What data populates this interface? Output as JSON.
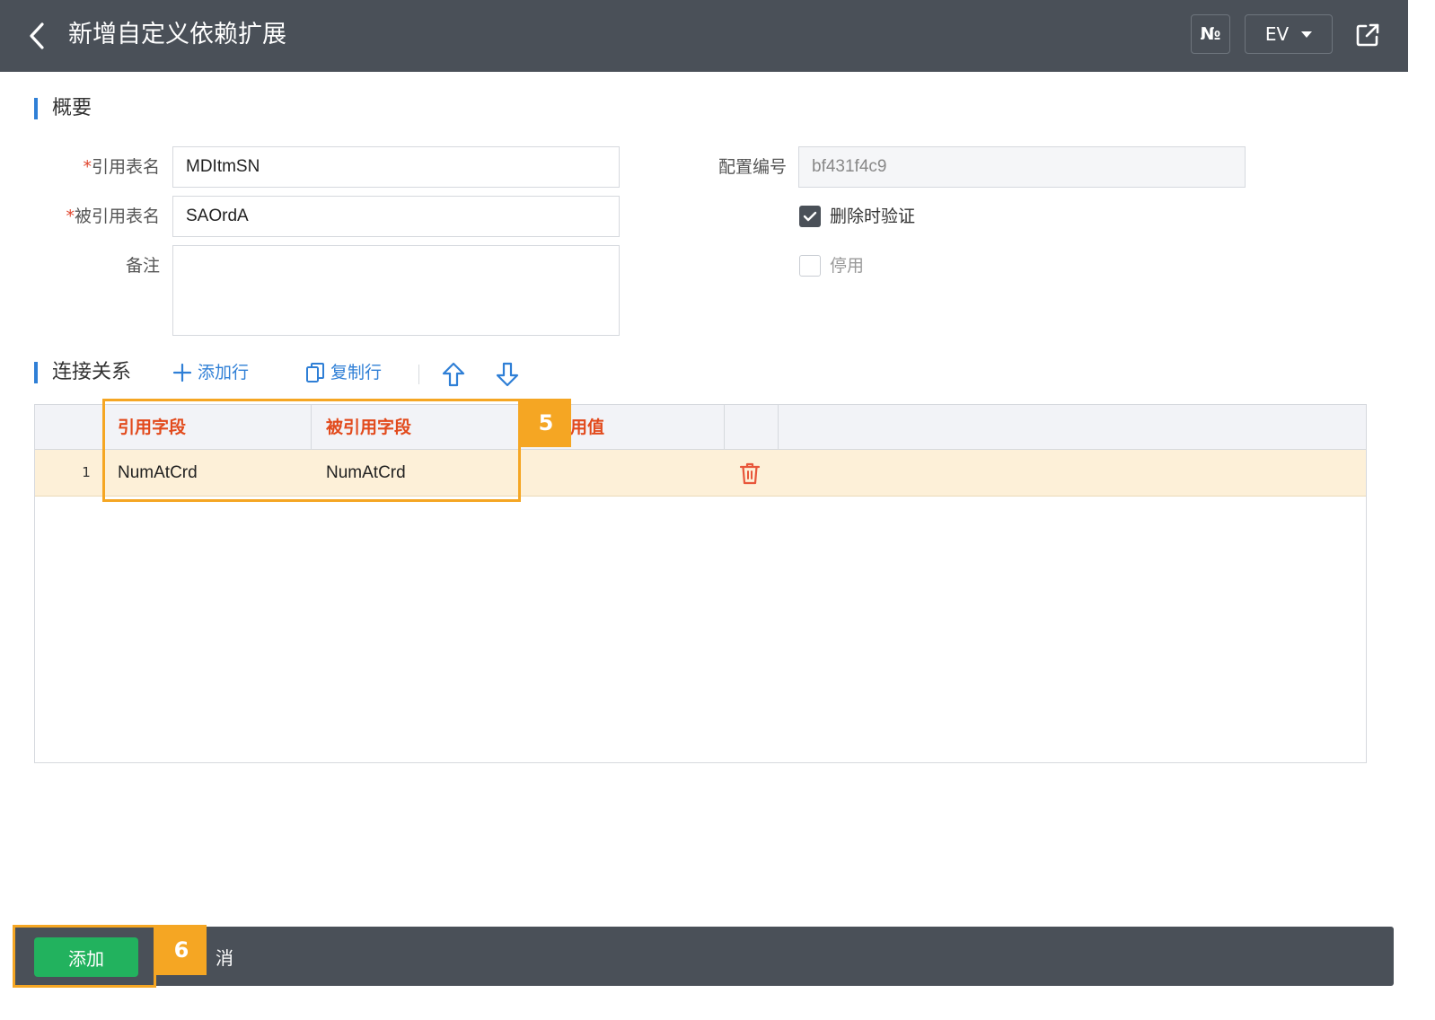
{
  "header": {
    "title": "新增自定义依赖扩展",
    "no_label": "№",
    "lang_label": "EV"
  },
  "overview": {
    "section_title": "概要",
    "ref_table": {
      "label": "引用表名",
      "value": "MDItmSN"
    },
    "referenced_table": {
      "label": "被引用表名",
      "value": "SAOrdA"
    },
    "remark": {
      "label": "备注",
      "value": ""
    },
    "config_no": {
      "label": "配置编号",
      "value": "bf431f4c9"
    },
    "validate_on_delete": {
      "label": "删除时验证",
      "checked": true
    },
    "disabled": {
      "label": "停用",
      "checked": false
    }
  },
  "relations": {
    "section_title": "连接关系",
    "add_row_label": "添加行",
    "copy_row_label": "复制行",
    "columns": [
      "引用字段",
      "被引用字段",
      "用值"
    ],
    "rows": [
      {
        "no": "1",
        "ref_field": "NumAtCrd",
        "referenced_field": "NumAtCrd",
        "value": ""
      }
    ]
  },
  "annotations": {
    "badge_5": "5",
    "badge_6": "6"
  },
  "footer": {
    "add_label": "添加",
    "cancel_label": "消"
  },
  "colors": {
    "header_bg": "#4a5058",
    "accent_blue": "#2f7fd6",
    "column_header_text": "#e24a1c",
    "selected_row_bg": "#fdf0d8",
    "highlight_orange": "#f5a623",
    "add_button": "#22b25e",
    "delete_icon": "#e8563a"
  }
}
